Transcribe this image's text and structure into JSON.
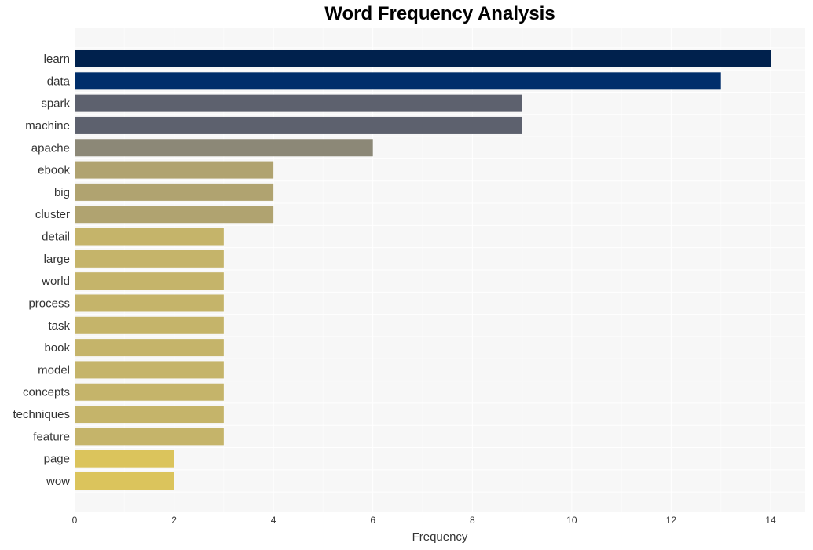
{
  "chart_data": {
    "type": "bar",
    "orientation": "horizontal",
    "title": "Word Frequency Analysis",
    "xlabel": "Frequency",
    "ylabel": "",
    "xlim": [
      0,
      14.7
    ],
    "xticks": [
      0,
      2,
      4,
      6,
      8,
      10,
      12,
      14
    ],
    "grid": true,
    "categories": [
      "learn",
      "data",
      "spark",
      "machine",
      "apache",
      "ebook",
      "big",
      "cluster",
      "detail",
      "large",
      "world",
      "process",
      "task",
      "book",
      "model",
      "concepts",
      "techniques",
      "feature",
      "page",
      "wow"
    ],
    "values": [
      14,
      13,
      9,
      9,
      6,
      4,
      4,
      4,
      3,
      3,
      3,
      3,
      3,
      3,
      3,
      3,
      3,
      3,
      2,
      2
    ],
    "colors": [
      "#00214d",
      "#002e6b",
      "#5d616e",
      "#5d616e",
      "#8c8877",
      "#b0a370",
      "#b0a370",
      "#b0a370",
      "#c5b46a",
      "#c5b46a",
      "#c5b46a",
      "#c5b46a",
      "#c5b46a",
      "#c5b46a",
      "#c5b46a",
      "#c5b46a",
      "#c5b46a",
      "#c5b46a",
      "#dbc45c",
      "#dbc45c"
    ]
  },
  "colors": {
    "plot_background": "#f7f7f7",
    "grid": "#ffffff"
  }
}
